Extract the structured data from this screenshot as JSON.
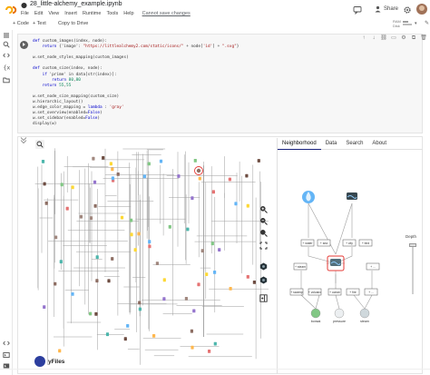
{
  "header": {
    "notebook_title": "28_little-alchemy_example.ipynb",
    "menu": [
      "File",
      "Edit",
      "View",
      "Insert",
      "Runtime",
      "Tools",
      "Help"
    ],
    "unsaved_notice": "Cannot save changes",
    "share_label": "Share",
    "icons": [
      "colab-logo",
      "github-icon",
      "comment-icon",
      "settings-icon",
      "avatar"
    ]
  },
  "toolbar": {
    "code_label": "+ Code",
    "text_label": "+ Text",
    "copy_label": "Copy to Drive",
    "ram_label": "RAM",
    "disk_label": "Disk",
    "editing_icon": "pencil-icon"
  },
  "rail": {
    "icons": [
      "menu-icon",
      "search-icon",
      "code-snippets-icon",
      "variables-icon",
      "files-icon",
      "terminal-icon",
      "command-icon",
      "console-icon"
    ]
  },
  "code": {
    "lines": [
      [
        {
          "t": "def ",
          "c": "kw"
        },
        {
          "t": "custom_images(index, node):"
        }
      ],
      [
        {
          "t": "    "
        },
        {
          "t": "return ",
          "c": "kw"
        },
        {
          "t": "{'image': "
        },
        {
          "t": "\"https://littlealchemy2.com/static/icons/\"",
          "c": "str"
        },
        {
          "t": " + node["
        },
        {
          "t": "'id'",
          "c": "str"
        },
        {
          "t": "] + "
        },
        {
          "t": "\".svg\"",
          "c": "str"
        },
        {
          "t": "}"
        }
      ],
      [
        {
          "t": ""
        }
      ],
      [
        {
          "t": "w.set_node_styles_mapping(custom_images)"
        }
      ],
      [
        {
          "t": ""
        }
      ],
      [
        {
          "t": "def ",
          "c": "kw"
        },
        {
          "t": "custom_size(index, node):"
        }
      ],
      [
        {
          "t": "    "
        },
        {
          "t": "if ",
          "c": "kw"
        },
        {
          "t": "'prime' in data[str(index)]:"
        }
      ],
      [
        {
          "t": "        "
        },
        {
          "t": "return ",
          "c": "kw"
        },
        {
          "t": "80",
          "c": "num"
        },
        {
          "t": ","
        },
        {
          "t": "80",
          "c": "num"
        }
      ],
      [
        {
          "t": "    "
        },
        {
          "t": "return ",
          "c": "kw"
        },
        {
          "t": "55",
          "c": "num"
        },
        {
          "t": ","
        },
        {
          "t": "55",
          "c": "num"
        }
      ],
      [
        {
          "t": ""
        }
      ],
      [
        {
          "t": "w.set_node_size_mapping(custom_size)"
        }
      ],
      [
        {
          "t": "w.hierarchic_layout()"
        }
      ],
      [
        {
          "t": "w.edge_color_mapping = "
        },
        {
          "t": "lambda",
          "c": "kw"
        },
        {
          "t": " : "
        },
        {
          "t": "'gray'",
          "c": "str"
        }
      ],
      [
        {
          "t": "w.set_overview(enabled="
        },
        {
          "t": "False",
          "c": "kw"
        },
        {
          "t": ")"
        }
      ],
      [
        {
          "t": "w.set_sidebar(enabled="
        },
        {
          "t": "False",
          "c": "kw"
        },
        {
          "t": ")"
        }
      ],
      [
        {
          "t": "display(w)"
        }
      ]
    ]
  },
  "sidebar": {
    "tabs": [
      "Neighborhood",
      "Data",
      "Search",
      "About"
    ],
    "active_tab": "Neighborhood",
    "depth_label": "Depth"
  },
  "neighborhood": {
    "nodes": [
      "water",
      "river",
      "+ steam",
      "+ water",
      "+ sea",
      "+ city",
      "+ bird",
      "+ swamp",
      "+ volcano",
      "+ ocean",
      "+ fire",
      "+ ..."
    ],
    "bottom_nodes": [
      "bonsai",
      "pressure",
      "steam"
    ]
  },
  "zoom_controls": [
    "zoom-in-icon",
    "zoom-out-icon",
    "fit-icon",
    "layout-icon",
    "graph-icon",
    "sidebar-toggle-icon"
  ],
  "branding": "yFiles",
  "colors": {
    "accent": "#1a237e",
    "highlight": "#e53935",
    "edge": "#9e9e9e"
  }
}
